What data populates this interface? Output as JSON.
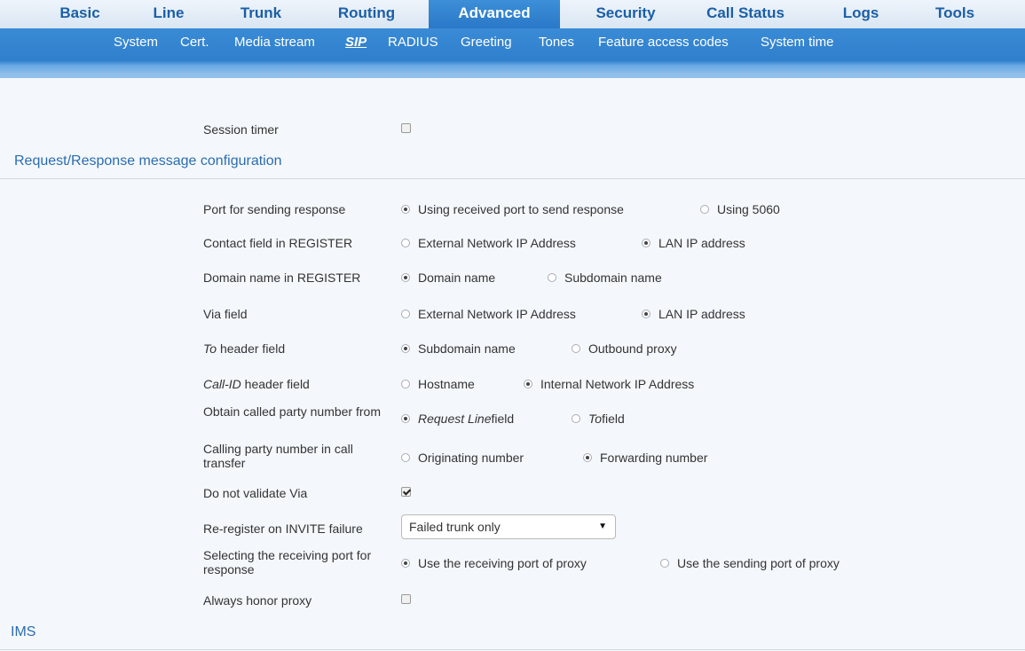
{
  "nav": {
    "tabs": [
      "Basic",
      "Line",
      "Trunk",
      "Routing",
      "Advanced",
      "Security",
      "Call Status",
      "Logs",
      "Tools"
    ],
    "active_tab": "Advanced",
    "subtabs": [
      "System",
      "Cert.",
      "Media stream",
      "SIP",
      "RADIUS",
      "Greeting",
      "Tones",
      "Feature access codes",
      "System time"
    ],
    "active_subtab": "SIP"
  },
  "session_timer": {
    "label": "Session timer",
    "checked": false
  },
  "section_request": "Request/Response message configuration",
  "rows": {
    "port": {
      "label": "Port for sending response",
      "opt1": "Using received port to send response",
      "opt2": "Using 5060",
      "selected": 1
    },
    "contact": {
      "label": "Contact field in REGISTER",
      "opt1": "External Network IP Address",
      "opt2": "LAN IP address",
      "selected": 2
    },
    "domain": {
      "label": "Domain name in REGISTER",
      "opt1": "Domain name",
      "opt2": "Subdomain name",
      "selected": 1
    },
    "via": {
      "label": "Via field",
      "opt1": "External Network IP Address",
      "opt2": "LAN IP address",
      "selected": 2
    },
    "to": {
      "label_em": "To",
      "label_rest": " header field",
      "opt1": "Subdomain name",
      "opt2": "Outbound proxy",
      "selected": 1
    },
    "callid": {
      "label_em": "Call-ID",
      "label_rest": " header field",
      "opt1": "Hostname",
      "opt2": "Internal Network IP Address",
      "selected": 2
    },
    "obtain": {
      "label": "Obtain called party number from",
      "opt1_em": "Request Line",
      "opt1_rest": " field",
      "opt2_em": "To",
      "opt2_rest": " field",
      "selected": 1
    },
    "calling": {
      "label": "Calling party number in call transfer",
      "opt1": "Originating number",
      "opt2": "Forwarding number",
      "selected": 2
    },
    "novalidate": {
      "label": "Do not validate Via",
      "checked": true
    },
    "reregister": {
      "label": "Re-register on INVITE failure",
      "value": "Failed trunk only"
    },
    "recvport": {
      "label": "Selecting the receiving port for response",
      "opt1": "Use the receiving port of proxy",
      "opt2": "Use the sending port of proxy",
      "selected": 1
    },
    "honor": {
      "label": "Always honor proxy",
      "checked": false
    }
  },
  "section_ims": "IMS"
}
